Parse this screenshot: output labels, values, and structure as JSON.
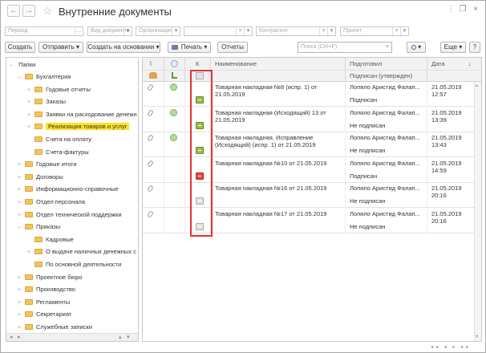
{
  "window": {
    "title": "Внутренние документы",
    "back_glyph": "←",
    "forward_glyph": "→",
    "star_glyph": "☆",
    "menu_glyph": "⋮",
    "restore_glyph": "❐",
    "close_glyph": "×"
  },
  "filters": {
    "period": "Период",
    "doc_type": "Вид документа",
    "organization": "Организация",
    "counterparty": "Контрагент",
    "project": "Проект",
    "dots": "...",
    "x": "×"
  },
  "toolbar": {
    "create": "Создать",
    "send": "Отправить",
    "create_based": "Создать на основании",
    "print": "Печать",
    "reports": "Отчеты",
    "search_placeholder": "Поиск (Ctrl+F)",
    "search_icon": "🔍",
    "clear": "×",
    "more": "Еще",
    "help": "?",
    "dropdown": "▾"
  },
  "tree": {
    "root": "Папки",
    "items": [
      {
        "label": "Бухгалтерия",
        "expander": "–"
      },
      {
        "label": "Годовые отчеты",
        "expander": "+"
      },
      {
        "label": "Заказы",
        "expander": "+"
      },
      {
        "label": "Заявки на расходование денежн",
        "expander": "+"
      },
      {
        "label": "Реализация товаров и услуг",
        "expander": "+"
      },
      {
        "label": "Счета на оплату",
        "expander": ""
      },
      {
        "label": "Счета-фактуры",
        "expander": ""
      },
      {
        "label": "Годовые итоги",
        "expander": "+"
      },
      {
        "label": "Договоры",
        "expander": "+"
      },
      {
        "label": "Информационно-справочные",
        "expander": "+"
      },
      {
        "label": "Отдел персонала",
        "expander": "+"
      },
      {
        "label": "Отдел технической поддержки",
        "expander": "+"
      },
      {
        "label": "Приказы",
        "expander": "–"
      },
      {
        "label": "Кадровые",
        "expander": ""
      },
      {
        "label": "О выдаче наличных денежных с",
        "expander": "+"
      },
      {
        "label": "По основной деятельности",
        "expander": ""
      },
      {
        "label": "Проектное бюро",
        "expander": "+"
      },
      {
        "label": "Производство",
        "expander": "+"
      },
      {
        "label": "Регламенты",
        "expander": "+"
      },
      {
        "label": "Секретариат",
        "expander": "+"
      },
      {
        "label": "Служебные записки",
        "expander": "+"
      }
    ],
    "scroll_glyphs": [
      "◂",
      "▸",
      "▴",
      "▾"
    ]
  },
  "table": {
    "headers": {
      "k": "К",
      "name": "Наименование",
      "prepared": "Подготовил",
      "date": "Дата",
      "sub": "Подписан (утвержден)",
      "sort": "↓"
    },
    "rows": [
      {
        "name1": "Товарная накладная №8 (испр. 1) от",
        "name2": "21.05.2019",
        "preparer": "Лопяло Аристид Фалап...",
        "status": "Подписан",
        "date": "21.05.2019",
        "time": "12:57",
        "color": "green",
        "circle": true
      },
      {
        "name1": "Товарная накладная (Исходящий) 13 от",
        "name2": "21.05.2019",
        "preparer": "Лопяло Аристид Фалап...",
        "status": "Не подписан",
        "date": "21.05.2019",
        "time": "13:39",
        "color": "green",
        "circle": true
      },
      {
        "name1": "Товарная накладная, Исправление",
        "name2": "(Исходящий) (испр. 1) от 21.05.2019",
        "preparer": "Лопяло Аристид Фалап...",
        "status": "Не подписан",
        "date": "21.05.2019",
        "time": "13:43",
        "color": "green",
        "circle": true
      },
      {
        "name1": "Товарная накладная №10 от 21.05.2019",
        "name2": "",
        "preparer": "Лопяло Аристид Фалап...",
        "status": "Подписан",
        "date": "21.05.2019",
        "time": "14:59",
        "color": "red",
        "circle": false
      },
      {
        "name1": "Товарная накладная №16 от 21.05.2019",
        "name2": "",
        "preparer": "Лопяло Аристид Фалап...",
        "status": "Не подписан",
        "date": "21.05.2019",
        "time": "20:16",
        "color": "gray",
        "circle": false
      },
      {
        "name1": "Товарная накладная №17 от 21.05.2019",
        "name2": "",
        "preparer": "Лопяло Аристид Фалап...",
        "status": "Не подписан",
        "date": "21.05.2019",
        "time": "20:16",
        "color": "gray",
        "circle": false
      }
    ],
    "scroll_up": "▴",
    "scroll_down": "▾",
    "bottom_glyphs": [
      "◂◂",
      "◂",
      "▸",
      "▸▸"
    ]
  },
  "colors": {
    "selected_folder": "#fde227",
    "highlight_border": "#e53333"
  }
}
